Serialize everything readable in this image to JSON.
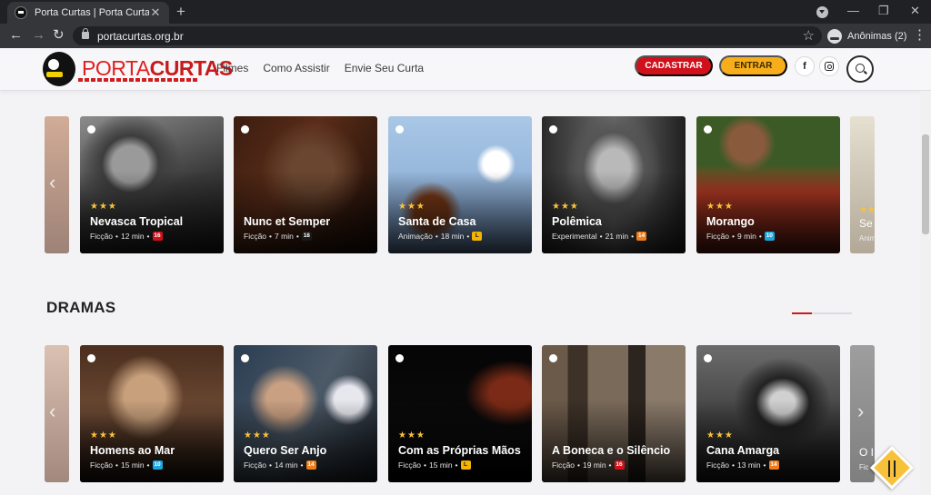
{
  "browser": {
    "tab_title": "Porta Curtas | Porta Curtas",
    "url": "portacurtas.org.br",
    "incognito_label": "Anônimas (2)"
  },
  "header": {
    "logo_porta": "PORTA",
    "logo_curtas": "CURTAS",
    "nav": [
      "Filmes",
      "Como Assistir",
      "Envie Seu Curta"
    ],
    "cadastrar_label": "CADASTRAR",
    "entrar_label": "ENTRAR",
    "facebook_label": "f"
  },
  "rating_colors": {
    "16": "#d0111b",
    "18": "#1a1a1a",
    "L": "#f4b400",
    "14": "#f07d1a",
    "10": "#1aa7e0"
  },
  "row1": {
    "peek_left": {},
    "peek_right": {
      "title": "Se",
      "meta": "Anim",
      "stars": "★★"
    },
    "cards": [
      {
        "title": "Nevasca Tropical",
        "genre": "Ficção",
        "duration": "12 min",
        "rating": "16",
        "stars": "★★★"
      },
      {
        "title": "Nunc et Semper",
        "genre": "Ficção",
        "duration": "7 min",
        "rating": "18",
        "stars": ""
      },
      {
        "title": "Santa de Casa",
        "genre": "Animação",
        "duration": "18 min",
        "rating": "L",
        "stars": "★★★"
      },
      {
        "title": "Polêmica",
        "genre": "Experimental",
        "duration": "21 min",
        "rating": "14",
        "stars": "★★★"
      },
      {
        "title": "Morango",
        "genre": "Ficção",
        "duration": "9 min",
        "rating": "10",
        "stars": "★★★"
      }
    ]
  },
  "section": {
    "title": "DRAMAS"
  },
  "row2": {
    "peek_left": {},
    "peek_right": {
      "title": "O I",
      "meta": "Fic",
      "stars": ""
    },
    "cards": [
      {
        "title": "Homens ao Mar",
        "genre": "Ficção",
        "duration": "15 min",
        "rating": "10",
        "stars": "★★★"
      },
      {
        "title": "Quero Ser Anjo",
        "genre": "Ficção",
        "duration": "14 min",
        "rating": "14",
        "stars": "★★★"
      },
      {
        "title": "Com as Próprias Mãos",
        "genre": "Ficção",
        "duration": "15 min",
        "rating": "L",
        "stars": "★★★"
      },
      {
        "title": "A Boneca e o Silêncio",
        "genre": "Ficção",
        "duration": "19 min",
        "rating": "16",
        "stars": ""
      },
      {
        "title": "Cana Amarga",
        "genre": "Ficção",
        "duration": "13 min",
        "rating": "14",
        "stars": "★★★"
      }
    ]
  }
}
